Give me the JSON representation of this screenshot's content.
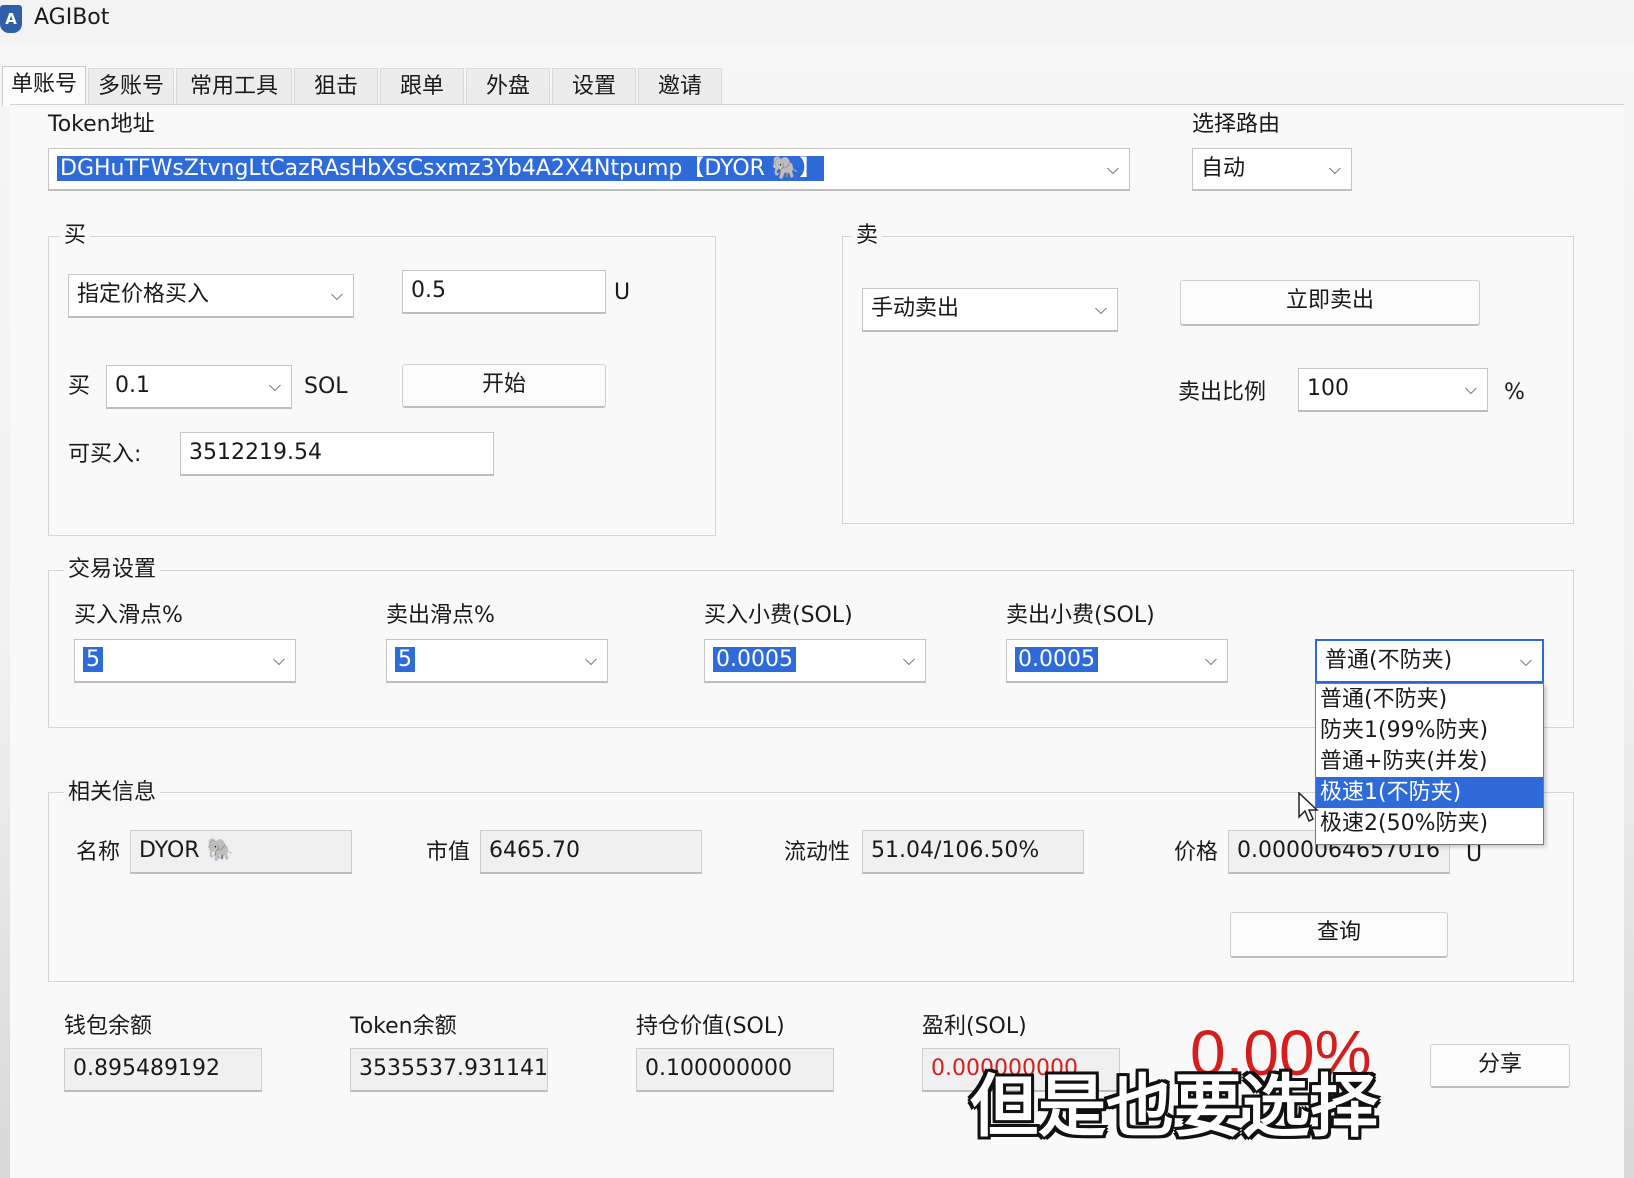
{
  "window": {
    "title": "AGIBot",
    "icon": "app-logo-icon"
  },
  "tabs": [
    {
      "label": "单账号",
      "active": true
    },
    {
      "label": "多账号"
    },
    {
      "label": "常用工具"
    },
    {
      "label": "狙击"
    },
    {
      "label": "跟单"
    },
    {
      "label": "外盘"
    },
    {
      "label": "设置"
    },
    {
      "label": "邀请"
    }
  ],
  "token": {
    "label": "Token地址",
    "value": "DGHuTFWsZtvngLtCazRAsHbXsCsxmz3Yb4A2X4Ntpump【DYOR 🐘】"
  },
  "route": {
    "label": "选择路由",
    "value": "自动"
  },
  "buy": {
    "legend": "买",
    "mode": "指定价格买入",
    "price_value": "0.5",
    "price_unit": "U",
    "amount_label": "买",
    "amount_value": "0.1",
    "amount_unit": "SOL",
    "start_label": "开始",
    "can_buy_label": "可买入:",
    "can_buy_value": "3512219.54"
  },
  "sell": {
    "legend": "卖",
    "mode": "手动卖出",
    "sell_now_label": "立即卖出",
    "ratio_label": "卖出比例",
    "ratio_value": "100",
    "ratio_unit": "%"
  },
  "trade_settings": {
    "legend": "交易设置",
    "buy_slippage_label": "买入滑点%",
    "buy_slippage_value": "5",
    "sell_slippage_label": "卖出滑点%",
    "sell_slippage_value": "5",
    "buy_fee_label": "买入小费(SOL)",
    "buy_fee_value": "0.0005",
    "sell_fee_label": "卖出小费(SOL)",
    "sell_fee_value": "0.0005",
    "mode_value": "普通(不防夹)",
    "mode_options": [
      "普通(不防夹)",
      "防夹1(99%防夹)",
      "普通+防夹(并发)",
      "极速1(不防夹)",
      "极速2(50%防夹)"
    ],
    "highlighted_option_index": 3
  },
  "info": {
    "legend": "相关信息",
    "name_label": "名称",
    "name_value": "DYOR 🐘",
    "mcap_label": "市值",
    "mcap_value": "6465.70",
    "liquidity_label": "流动性",
    "liquidity_value": "51.04/106.50%",
    "price_label": "价格",
    "price_value": "0.000006465701‍6",
    "price_unit": "U",
    "query_label": "查询"
  },
  "footer": {
    "wallet_label": "钱包余额",
    "wallet_value": "0.895489192",
    "token_balance_label": "Token余额",
    "token_balance_value": "3535537.931141",
    "position_label": "持仓价值(SOL)",
    "position_value": "0.100000000",
    "profit_label": "盈利(SOL)",
    "profit_value": "0.000000000",
    "profit_percent": "0.00%",
    "share_label": "分享"
  },
  "subtitle": "但是也要选择",
  "colors": {
    "selection": "#2e6ad8",
    "profit": "#d41e1e"
  }
}
